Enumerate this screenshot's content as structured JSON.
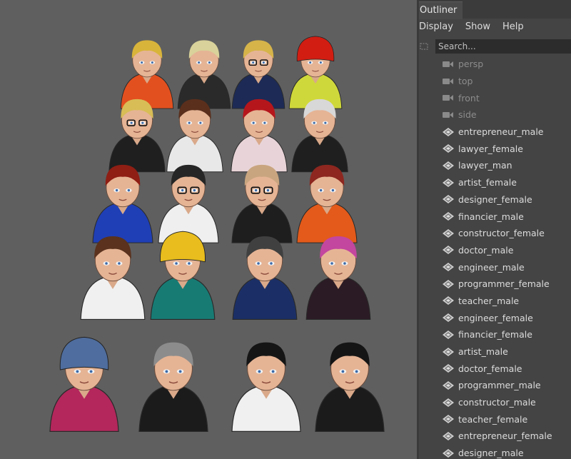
{
  "outliner": {
    "title": "Outliner",
    "menu": [
      "Display",
      "Show",
      "Help"
    ],
    "search_placeholder": "Search...",
    "cameras": [
      {
        "label": "persp",
        "icon": "camera-icon"
      },
      {
        "label": "top",
        "icon": "camera-icon"
      },
      {
        "label": "front",
        "icon": "camera-icon"
      },
      {
        "label": "side",
        "icon": "camera-icon"
      }
    ],
    "objects": [
      {
        "label": "entrepreneur_male",
        "icon": "mesh-transform-icon"
      },
      {
        "label": "lawyer_female",
        "icon": "mesh-transform-icon"
      },
      {
        "label": "lawyer_man",
        "icon": "mesh-transform-icon"
      },
      {
        "label": "artist_female",
        "icon": "mesh-transform-icon"
      },
      {
        "label": "designer_female",
        "icon": "mesh-transform-icon"
      },
      {
        "label": "financier_male",
        "icon": "mesh-transform-icon"
      },
      {
        "label": "constructor_female",
        "icon": "mesh-transform-icon"
      },
      {
        "label": "doctor_male",
        "icon": "mesh-transform-icon"
      },
      {
        "label": "engineer_male",
        "icon": "mesh-transform-icon"
      },
      {
        "label": "programmer_female",
        "icon": "mesh-transform-icon"
      },
      {
        "label": "teacher_male",
        "icon": "mesh-transform-icon"
      },
      {
        "label": "engineer_female",
        "icon": "mesh-transform-icon"
      },
      {
        "label": "financier_female",
        "icon": "mesh-transform-icon"
      },
      {
        "label": "artist_male",
        "icon": "mesh-transform-icon"
      },
      {
        "label": "doctor_female",
        "icon": "mesh-transform-icon"
      },
      {
        "label": "programmer_male",
        "icon": "mesh-transform-icon"
      },
      {
        "label": "constructor_male",
        "icon": "mesh-transform-icon"
      },
      {
        "label": "teacher_female",
        "icon": "mesh-transform-icon"
      },
      {
        "label": "entrepreneur_female",
        "icon": "mesh-transform-icon"
      },
      {
        "label": "designer_male",
        "icon": "mesh-transform-icon"
      }
    ]
  },
  "viewport": {
    "background": "#5f5f5f",
    "characters": [
      {
        "hair": "#d8b43a",
        "body": "#e3501f",
        "glasses": false,
        "hat": false
      },
      {
        "hair": "#d9d29a",
        "body": "#2a2a2a",
        "glasses": false,
        "hat": false
      },
      {
        "hair": "#d6b44a",
        "body": "#1d2a55",
        "glasses": true,
        "hat": false
      },
      {
        "hair": "#d21d12",
        "body": "#cfd83a",
        "glasses": false,
        "hat": true
      },
      {
        "hair": "#d8bd56",
        "body": "#1f1f1f",
        "glasses": true,
        "hat": false
      },
      {
        "hair": "#5a2f1c",
        "body": "#e8e8e8",
        "glasses": false,
        "hat": false
      },
      {
        "hair": "#b5161c",
        "body": "#e8d4d8",
        "glasses": false,
        "hat": false
      },
      {
        "hair": "#d8d8d8",
        "body": "#1f1f1f",
        "glasses": false,
        "hat": false
      },
      {
        "hair": "#8f1e14",
        "body": "#1f3fb6",
        "glasses": false,
        "hat": false
      },
      {
        "hair": "#262626",
        "body": "#efefef",
        "glasses": true,
        "hat": false
      },
      {
        "hair": "#c9a57f",
        "body": "#1e1e1e",
        "glasses": true,
        "hat": false
      },
      {
        "hair": "#8d271f",
        "body": "#e35a1a",
        "glasses": false,
        "hat": false
      },
      {
        "hair": "#5a321d",
        "body": "#f0f0f0",
        "glasses": false,
        "hat": false
      },
      {
        "hair": "#e8bd1d",
        "body": "#177b74",
        "glasses": false,
        "hat": true
      },
      {
        "hair": "#404040",
        "body": "#1b2f66",
        "glasses": false,
        "hat": false
      },
      {
        "hair": "#c3469f",
        "body": "#2b1b24",
        "glasses": false,
        "hat": false
      },
      {
        "hair": "#4f6d9e",
        "body": "#b3275c",
        "glasses": false,
        "hat": true
      },
      {
        "hair": "#8c8c8c",
        "body": "#1b1b1b",
        "glasses": false,
        "hat": false
      },
      {
        "hair": "#151515",
        "body": "#f0f0f0",
        "glasses": false,
        "hat": false
      },
      {
        "hair": "#151515",
        "body": "#1b1b1b",
        "glasses": false,
        "hat": false
      }
    ]
  }
}
